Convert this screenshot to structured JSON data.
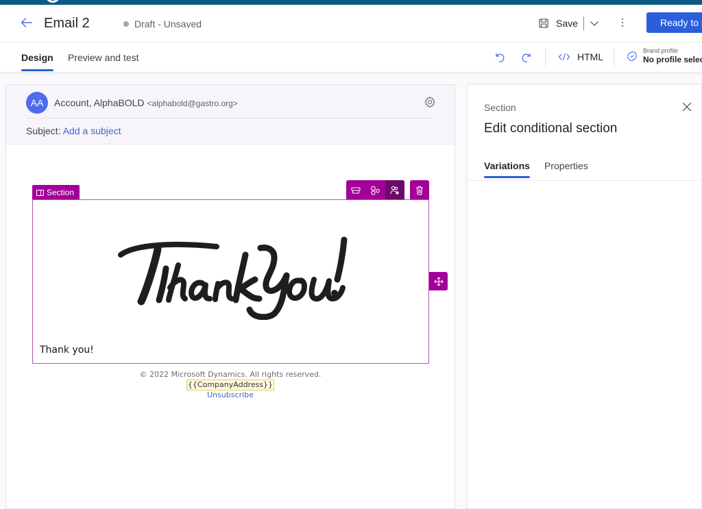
{
  "header": {
    "title": "Email 2",
    "status": "Draft - Unsaved",
    "save_label": "Save",
    "ready_label": "Ready to send"
  },
  "toolbar": {
    "tabs": [
      {
        "label": "Design",
        "active": true
      },
      {
        "label": "Preview and test",
        "active": false
      }
    ],
    "html_label": "HTML",
    "brand_profile_label": "Brand profile",
    "brand_profile_value": "No profile selected"
  },
  "email": {
    "avatar_initials": "AA",
    "from_name": "Account, AlphaBOLD",
    "from_address": "<alphabold@gastro.org>",
    "subject_label": "Subject:",
    "subject_placeholder": "Add a subject",
    "section_tag": "Section",
    "image_alt": "Thank You!",
    "body_text": "Thank you!",
    "footer": {
      "copyright": "© 2022 Microsoft Dynamics. All rights reserved.",
      "address_token": "{{CompanyAddress}}",
      "unsubscribe": "Unsubscribe"
    }
  },
  "panel": {
    "kicker": "Section",
    "title": "Edit conditional section",
    "tabs": [
      {
        "label": "Variations",
        "active": true
      },
      {
        "label": "Properties",
        "active": false
      }
    ]
  },
  "colors": {
    "accent": "#2b5fd9",
    "section_magenta": "#a3009a",
    "section_tool_selected": "#6e0a6a",
    "top_bar": "#0c5a86",
    "avatar": "#4f6bed"
  }
}
